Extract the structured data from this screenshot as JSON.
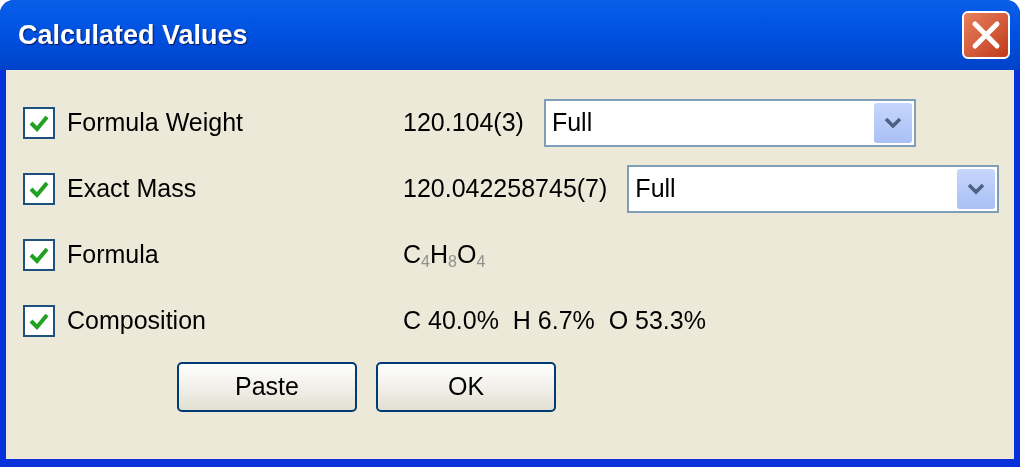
{
  "window": {
    "title": "Calculated Values"
  },
  "rows": [
    {
      "label": "Formula Weight",
      "checked": true,
      "value": "120.104(3)",
      "dropdown": {
        "value": "Full"
      }
    },
    {
      "label": "Exact Mass",
      "checked": true,
      "value": "120.042258745(7)",
      "dropdown": {
        "value": "Full"
      }
    },
    {
      "label": "Formula",
      "checked": true,
      "value": "C$_{4}$H$_{8}$O$_{4}$"
    },
    {
      "label": "Composition",
      "checked": true,
      "value": "C 40.0%  H 6.7%  O 53.3%"
    }
  ],
  "buttons": [
    "Paste",
    "OK"
  ]
}
